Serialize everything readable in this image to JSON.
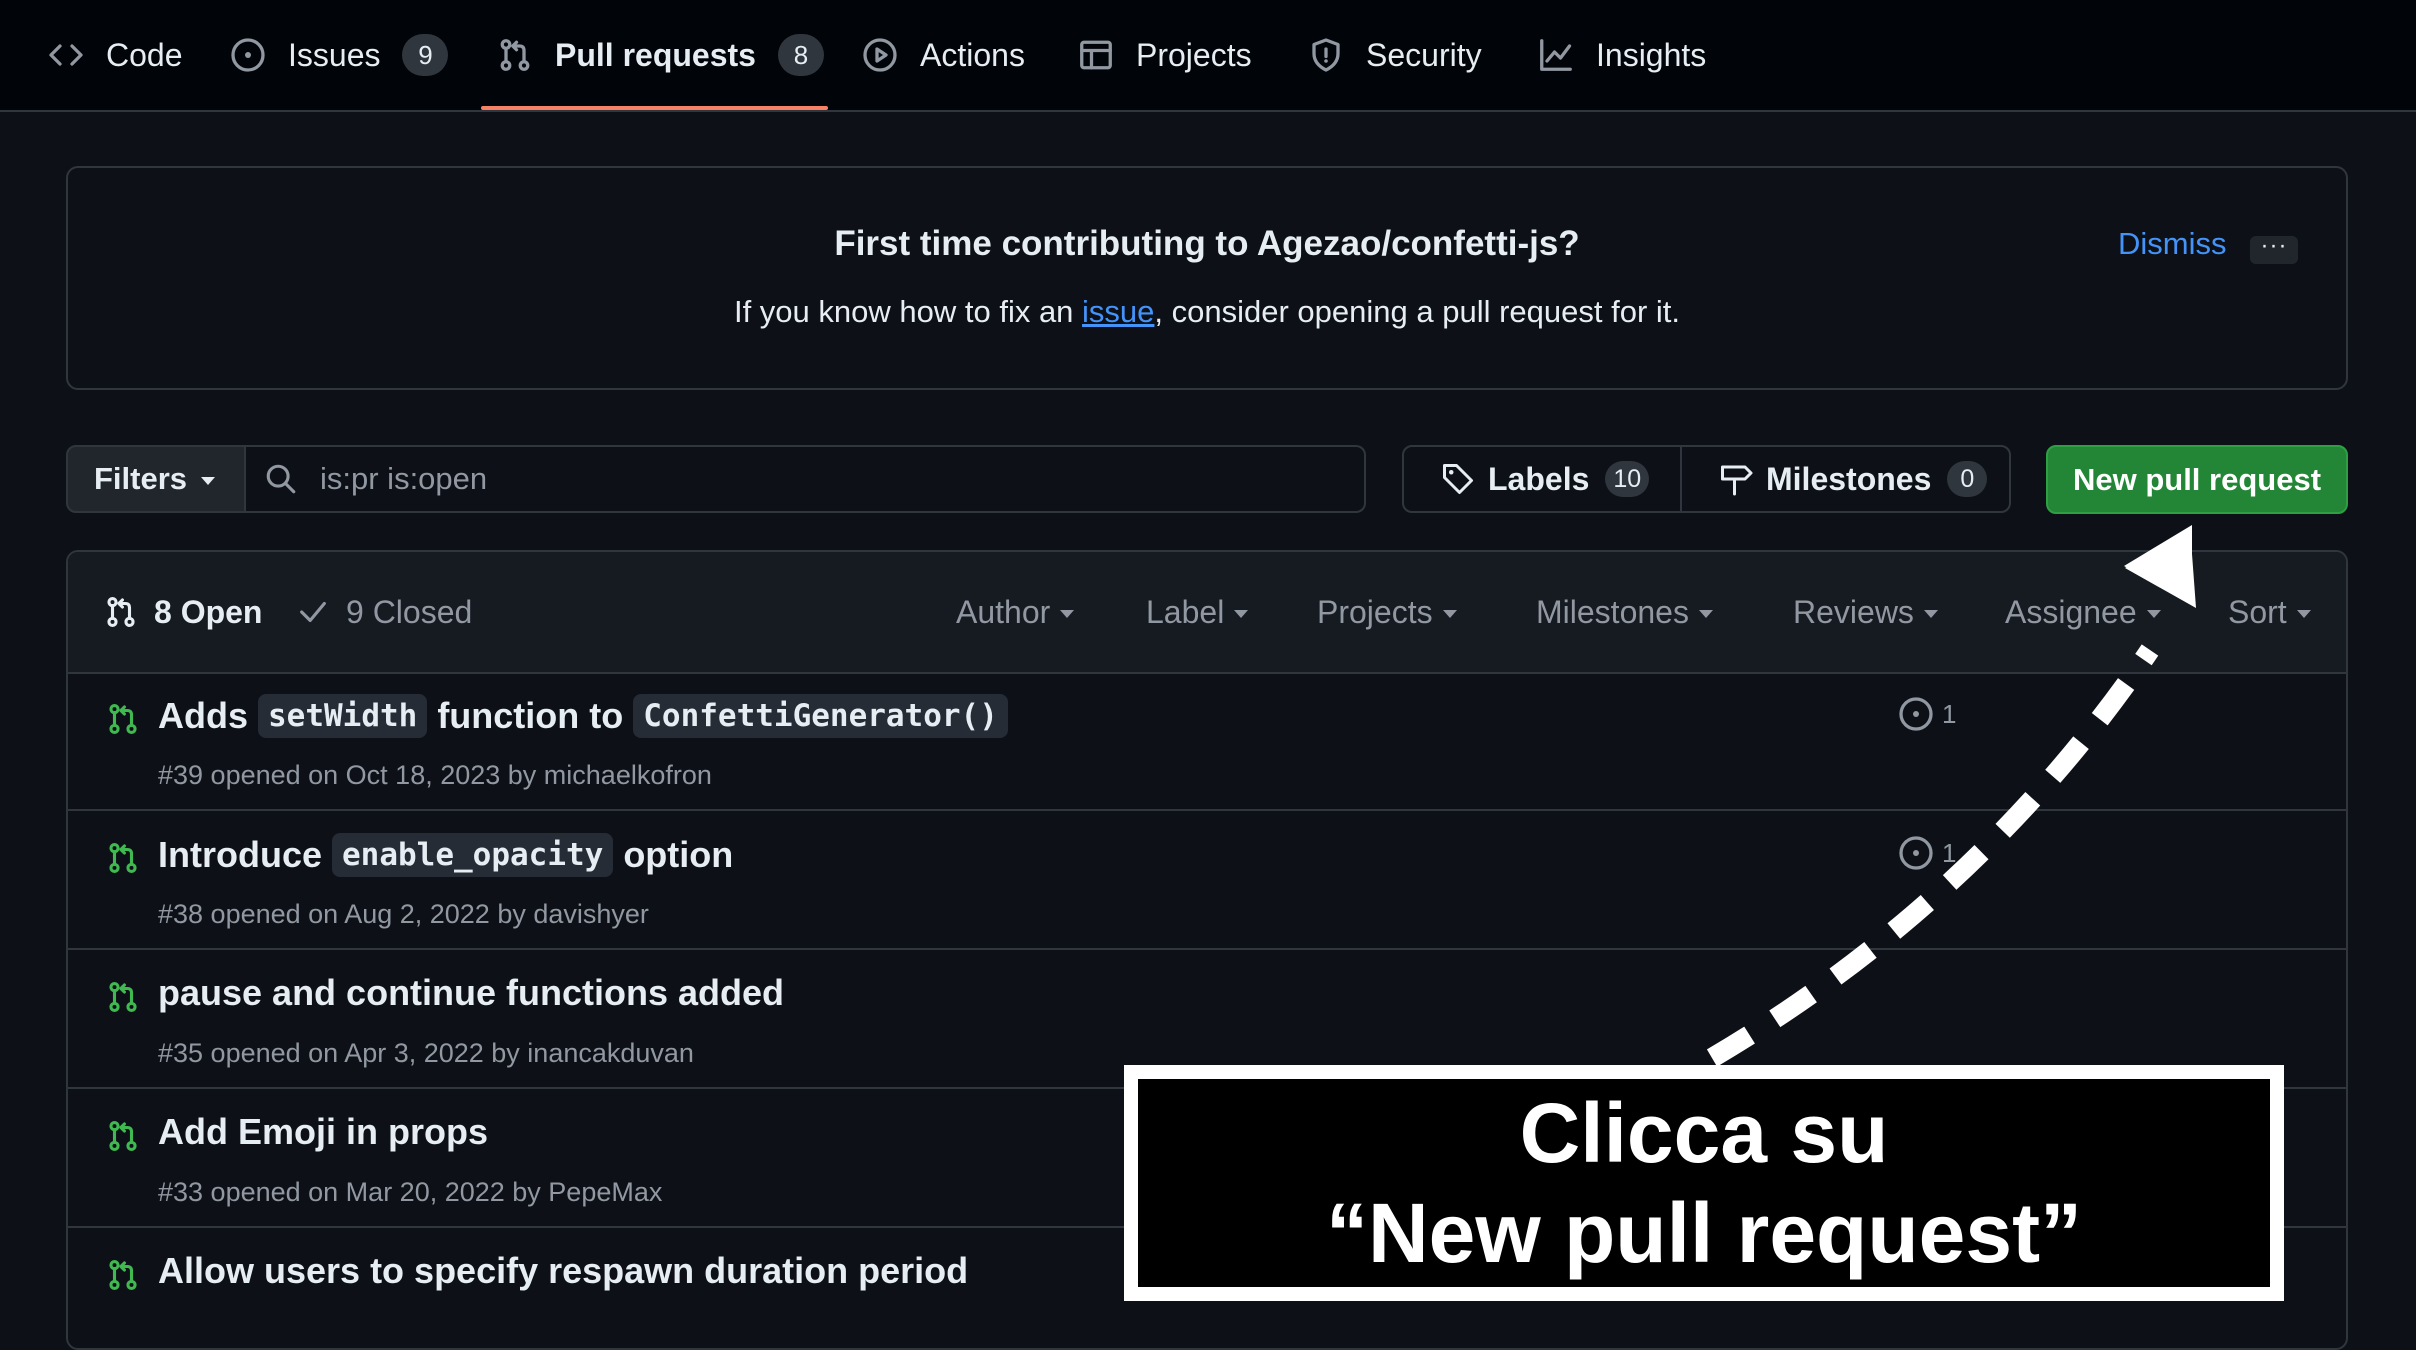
{
  "nav": {
    "tabs": [
      {
        "label": "Code",
        "icon": "code-icon"
      },
      {
        "label": "Issues",
        "icon": "issue-opened-icon",
        "count": "9"
      },
      {
        "label": "Pull requests",
        "icon": "git-pull-request-icon",
        "count": "8",
        "active": true
      },
      {
        "label": "Actions",
        "icon": "play-icon"
      },
      {
        "label": "Projects",
        "icon": "table-icon"
      },
      {
        "label": "Security",
        "icon": "shield-icon"
      },
      {
        "label": "Insights",
        "icon": "graph-icon"
      }
    ]
  },
  "banner": {
    "title": "First time contributing to Agezao/confetti-js?",
    "text_before": "If you know how to fix an ",
    "link": "issue",
    "text_after": ", consider opening a pull request for it.",
    "dismiss": "Dismiss",
    "more": "···"
  },
  "toolbar": {
    "filters_label": "Filters",
    "search_value": "is:pr is:open",
    "labels_label": "Labels",
    "labels_count": "10",
    "milestones_label": "Milestones",
    "milestones_count": "0",
    "new_pr_label": "New pull request"
  },
  "list": {
    "open_label": "8 Open",
    "closed_label": "9 Closed",
    "filters": [
      "Author",
      "Label",
      "Projects",
      "Milestones",
      "Reviews",
      "Assignee",
      "Sort"
    ],
    "rows": [
      {
        "parts": [
          {
            "t": "Adds "
          },
          {
            "c": "setWidth"
          },
          {
            "t": " function to "
          },
          {
            "c": "ConfettiGenerator()"
          }
        ],
        "meta": "#39 opened on Oct 18, 2023 by michaelkofron",
        "linked": "1"
      },
      {
        "parts": [
          {
            "t": "Introduce "
          },
          {
            "c": "enable_opacity"
          },
          {
            "t": " option"
          }
        ],
        "meta": "#38 opened on Aug 2, 2022 by davishyer",
        "linked": "1"
      },
      {
        "parts": [
          {
            "t": "pause and continue functions added"
          }
        ],
        "meta": "#35 opened on Apr 3, 2022 by inancakduvan",
        "linked": ""
      },
      {
        "parts": [
          {
            "t": "Add Emoji in props"
          }
        ],
        "meta": "#33 opened on Mar 20, 2022 by PepeMax",
        "linked": ""
      },
      {
        "parts": [
          {
            "t": "Allow users to specify respawn duration period"
          }
        ],
        "meta": "",
        "linked": ""
      }
    ]
  },
  "annotation": {
    "line1": "Clicca su",
    "line2": "“New pull request”"
  },
  "colors": {
    "background": "#0d1117",
    "nav_background": "#010409",
    "border": "#30363d",
    "accent_link": "#4493f8",
    "active_tab_underline": "#f78166",
    "primary_button": "#238636",
    "open_pr_icon": "#3fb950"
  }
}
